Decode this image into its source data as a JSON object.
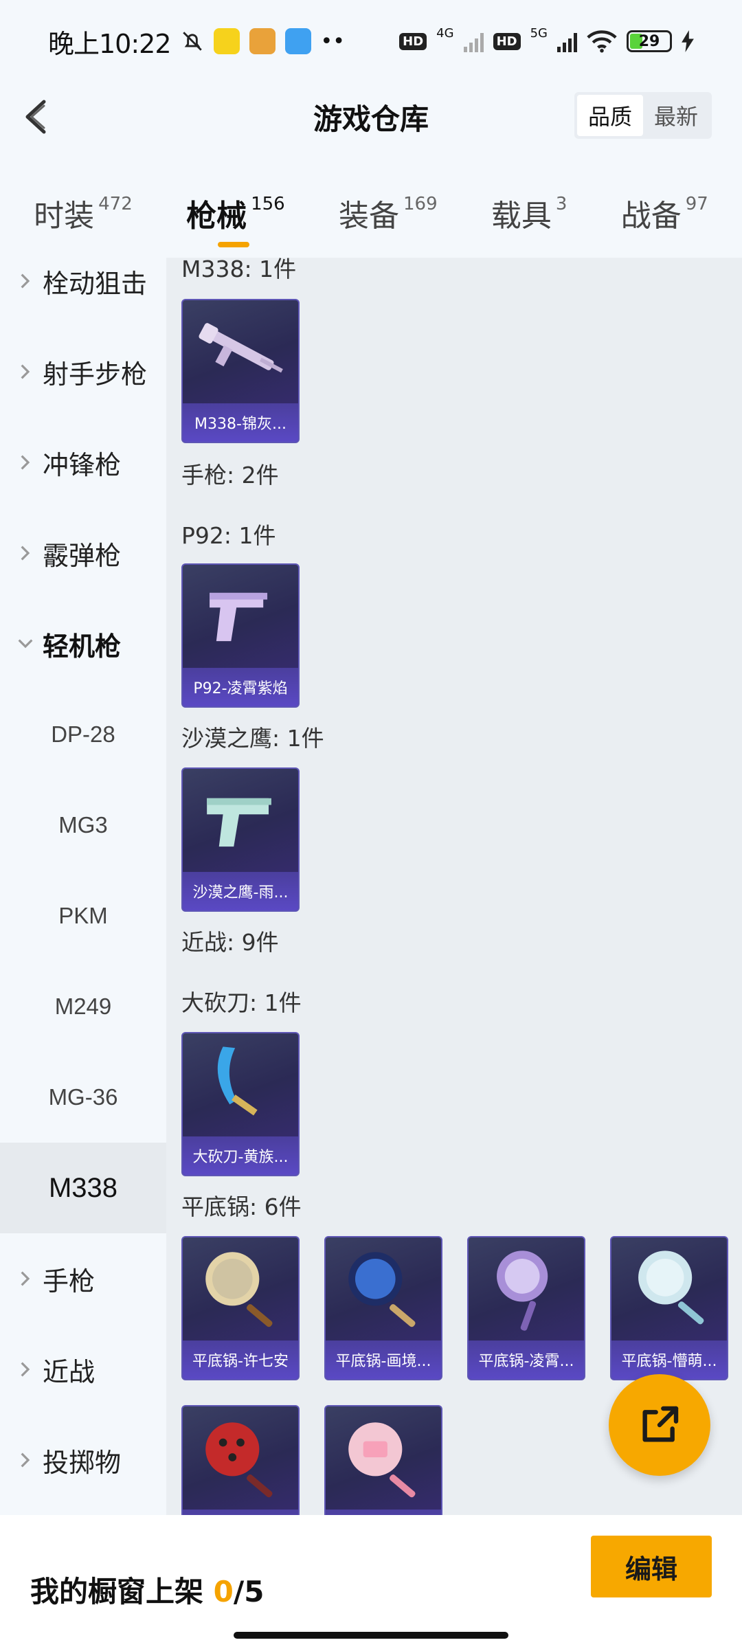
{
  "status_bar": {
    "time": "晚上10:22",
    "net1": "4G",
    "net2": "5G",
    "hd": "HD",
    "battery": "29"
  },
  "header": {
    "title": "游戏仓库",
    "sort_quality": "品质",
    "sort_newest": "最新"
  },
  "tabs": [
    {
      "label": "时装",
      "count": "472"
    },
    {
      "label": "枪械",
      "count": "156"
    },
    {
      "label": "装备",
      "count": "169"
    },
    {
      "label": "载具",
      "count": "3"
    },
    {
      "label": "战备",
      "count": "97"
    }
  ],
  "sidebar": {
    "items": [
      {
        "label": "栓动狙击"
      },
      {
        "label": "射手步枪"
      },
      {
        "label": "冲锋枪"
      },
      {
        "label": "霰弹枪"
      },
      {
        "label": "轻机枪"
      },
      {
        "label": "DP-28"
      },
      {
        "label": "MG3"
      },
      {
        "label": "PKM"
      },
      {
        "label": "M249"
      },
      {
        "label": "MG-36"
      },
      {
        "label": "M338"
      },
      {
        "label": "手枪"
      },
      {
        "label": "近战"
      },
      {
        "label": "投掷物"
      }
    ]
  },
  "content": {
    "sections": [
      {
        "label": "M338: 1件"
      },
      {
        "label": "手枪: 2件"
      },
      {
        "label": "P92: 1件"
      },
      {
        "label": "沙漠之鹰: 1件"
      },
      {
        "label": "近战: 9件"
      },
      {
        "label": "大砍刀: 1件"
      },
      {
        "label": "平底锅: 6件"
      }
    ],
    "items": [
      {
        "name": "M338-锦灰..."
      },
      {
        "name": "P92-凌霄紫焰"
      },
      {
        "name": "沙漠之鹰-雨..."
      },
      {
        "name": "大砍刀-黄族..."
      },
      {
        "name": "平底锅-许七安"
      },
      {
        "name": "平底锅-画境..."
      },
      {
        "name": "平底锅-凌霄..."
      },
      {
        "name": "平底锅-懵萌..."
      },
      {
        "name": ""
      },
      {
        "name": ""
      }
    ]
  },
  "bottom": {
    "showcase_label": "我的橱窗上架",
    "current": "0",
    "total": "/5",
    "edit": "编辑"
  },
  "colors": {
    "accent": "#f7a800",
    "card_bg": "#2b2a55",
    "card_caption": "#5a49c4"
  }
}
